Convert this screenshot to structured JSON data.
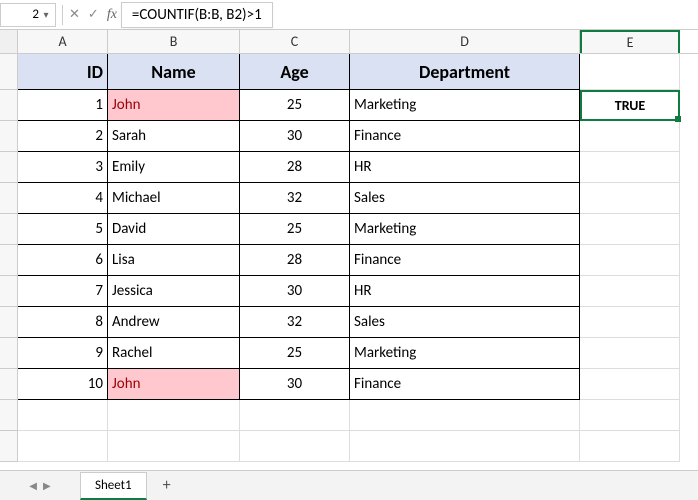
{
  "formulaBar": {
    "nameBox": "2",
    "formula": "=COUNTIF(B:B, B2)>1"
  },
  "columns": [
    "A",
    "B",
    "C",
    "D",
    "E"
  ],
  "headerRow": {
    "A": "ID",
    "B": "Name",
    "C": "Age",
    "D": "Department",
    "E": ""
  },
  "resultCell": "TRUE",
  "rows": [
    {
      "A": "1",
      "B": "John",
      "C": "25",
      "D": "Marketing",
      "dup": true
    },
    {
      "A": "2",
      "B": "Sarah",
      "C": "30",
      "D": "Finance"
    },
    {
      "A": "3",
      "B": "Emily",
      "C": "28",
      "D": "HR"
    },
    {
      "A": "4",
      "B": "Michael",
      "C": "32",
      "D": "Sales"
    },
    {
      "A": "5",
      "B": "David",
      "C": "25",
      "D": "Marketing"
    },
    {
      "A": "6",
      "B": "Lisa",
      "C": "28",
      "D": "Finance"
    },
    {
      "A": "7",
      "B": "Jessica",
      "C": "30",
      "D": "HR"
    },
    {
      "A": "8",
      "B": "Andrew",
      "C": "32",
      "D": "Sales"
    },
    {
      "A": "9",
      "B": "Rachel",
      "C": "25",
      "D": "Marketing"
    },
    {
      "A": "10",
      "B": "John",
      "C": "30",
      "D": "Finance",
      "dup": true
    }
  ],
  "emptyRows": 2,
  "tabs": {
    "active": "Sheet1",
    "addIcon": "+"
  }
}
